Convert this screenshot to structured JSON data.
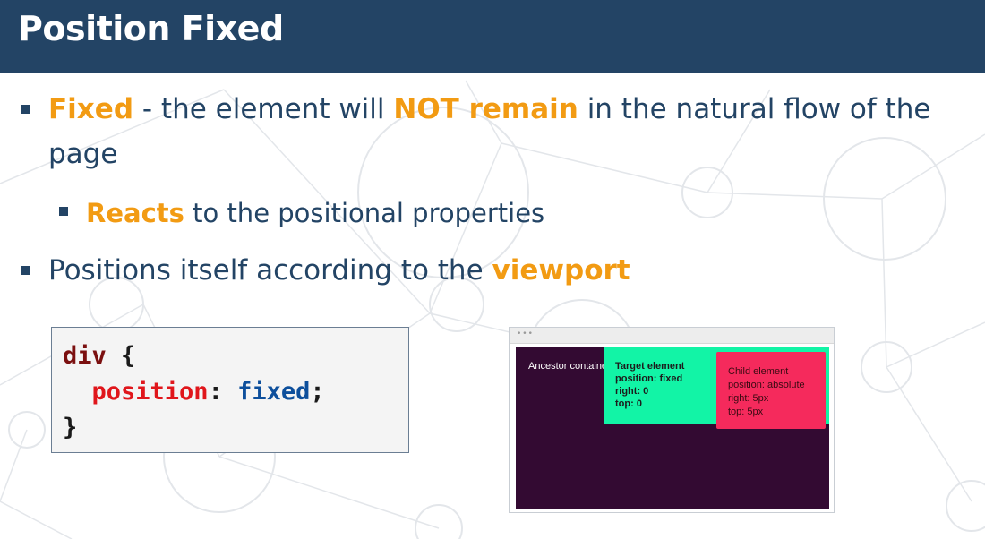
{
  "slide": {
    "title": "Position Fixed",
    "bullets": {
      "b1": {
        "hl1": "Fixed",
        "t1": " - the element will ",
        "hl2": "NOT remain",
        "t2": " in the natural flow of the page"
      },
      "b2": {
        "hl1": "Reacts",
        "t1": " to the positional properties"
      },
      "b3": {
        "t1": "Positions itself according to the ",
        "hl1": "viewport"
      }
    }
  },
  "code": {
    "selector": "div",
    "open_brace": " {",
    "property": "position",
    "colon": ": ",
    "value": "fixed",
    "semicolon": ";",
    "close_brace": "}"
  },
  "demo": {
    "browser_dots": "•••",
    "ancestor_label": "Ancestor container",
    "target_lines": [
      "Target element",
      "position: fixed",
      "right: 0",
      "top: 0"
    ],
    "child_lines": [
      "Child element",
      "position: absolute",
      "right: 5px",
      "top: 5px"
    ]
  },
  "colors": {
    "title_bar": "#234465",
    "highlight": "#f29b13",
    "viewport": "#330a32",
    "target": "#12f4a6",
    "child": "#f52a5c"
  }
}
